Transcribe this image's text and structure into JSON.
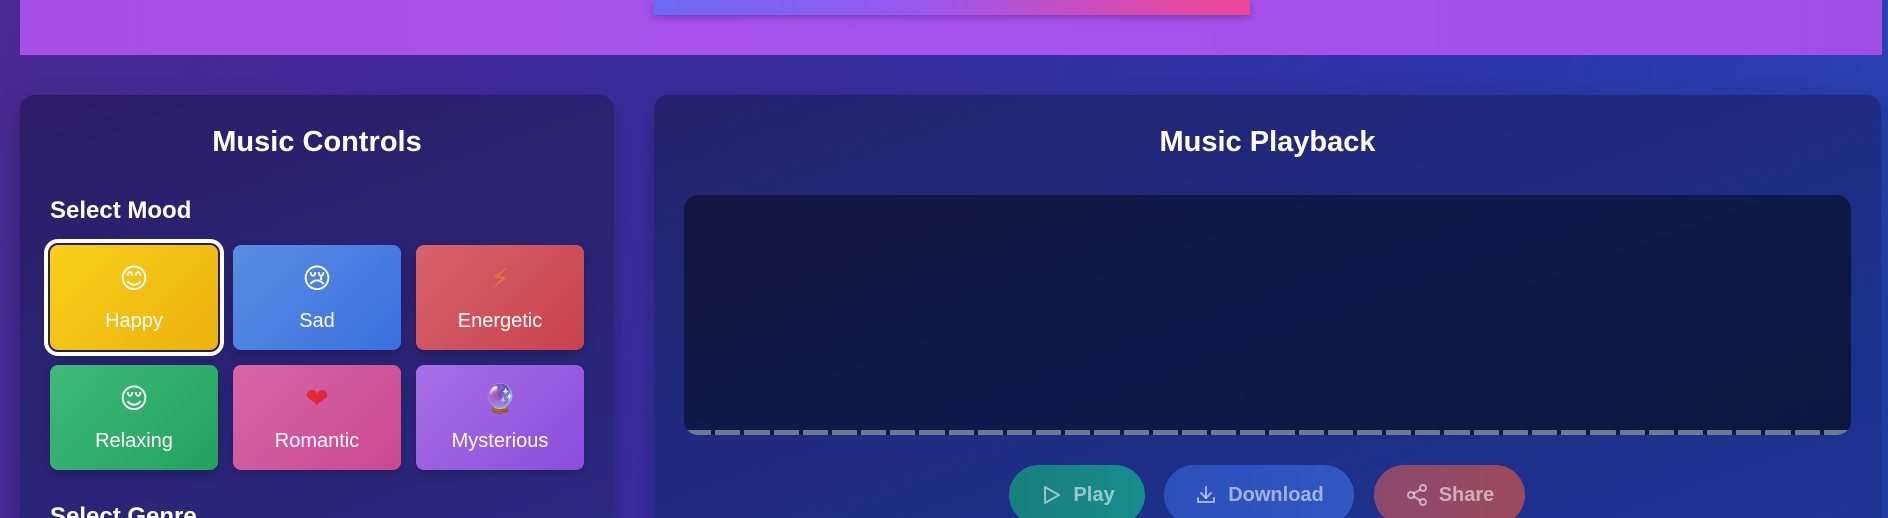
{
  "controls": {
    "title": "Music Controls",
    "mood_label": "Select Mood",
    "genre_label": "Select Genre",
    "moods": [
      {
        "label": "Happy",
        "emoji": "😊",
        "icon": "smiling-face-icon",
        "color": "#f5c518",
        "selected": true
      },
      {
        "label": "Sad",
        "emoji": "😢",
        "icon": "sad-face-icon",
        "color": "#4a7fe0",
        "selected": false
      },
      {
        "label": "Energetic",
        "emoji": "⚡",
        "icon": "lightning-icon",
        "color": "#d04e58",
        "selected": false
      },
      {
        "label": "Relaxing",
        "emoji": "😌",
        "icon": "relieved-face-icon",
        "color": "#2fae6a",
        "selected": false
      },
      {
        "label": "Romantic",
        "emoji": "❤",
        "icon": "heart-icon",
        "color": "#d0559c",
        "selected": false
      },
      {
        "label": "Mysterious",
        "emoji": "🔮",
        "icon": "crystal-ball-icon",
        "color": "#9658e0",
        "selected": false
      }
    ]
  },
  "playback": {
    "title": "Music Playback",
    "buttons": {
      "play": "Play",
      "download": "Download",
      "share": "Share"
    }
  },
  "colors": {
    "banner": "#a852ee",
    "play_button": "#168c8a",
    "download_button": "#3057c2",
    "share_button": "#9c4a5a"
  }
}
